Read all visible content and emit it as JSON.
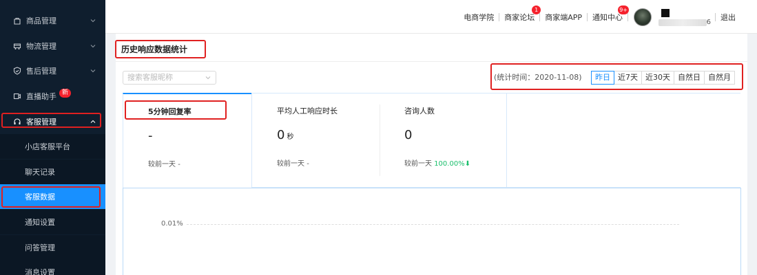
{
  "sidebar": {
    "items": [
      {
        "label": "商品管理",
        "icon": "bag-icon"
      },
      {
        "label": "物流管理",
        "icon": "truck-icon"
      },
      {
        "label": "售后管理",
        "icon": "shield-icon"
      },
      {
        "label": "直播助手",
        "icon": "video-icon",
        "badge": "新"
      },
      {
        "label": "客服管理",
        "icon": "headset-icon"
      }
    ],
    "sub_items": [
      "小店客服平台",
      "聊天记录",
      "客服数据",
      "通知设置",
      "问答管理",
      "消息设置"
    ]
  },
  "topbar": {
    "links": [
      "电商学院",
      "商家论坛",
      "商家端APP",
      "通知中心",
      "退出"
    ],
    "forum_badge": "1",
    "notice_badge": "9+",
    "user_suffix": "6"
  },
  "content": {
    "title": "历史响应数据统计",
    "select_placeholder": "搜索客服昵称",
    "stat_time": "(统计时间：2020-11-08)",
    "ranges": [
      "昨日",
      "近7天",
      "近30天",
      "自然日",
      "自然月"
    ],
    "metrics": [
      {
        "name": "5分钟回复率",
        "value": "-",
        "unit": "",
        "compare_prefix": "较前一天",
        "compare_value": "-"
      },
      {
        "name": "平均人工响应时长",
        "value": "0",
        "unit": "秒",
        "compare_prefix": "较前一天",
        "compare_value": "-"
      },
      {
        "name": "咨询人数",
        "value": "0",
        "unit": "",
        "compare_prefix": "较前一天",
        "compare_value": "100.00%"
      }
    ],
    "chart_axis_label": "0.01%"
  },
  "colors": {
    "sidebar_bg": "#0f1e2e",
    "accent": "#1890ff",
    "annotation": "#e02020",
    "badge": "#f5222d",
    "up": "#19be6b"
  }
}
